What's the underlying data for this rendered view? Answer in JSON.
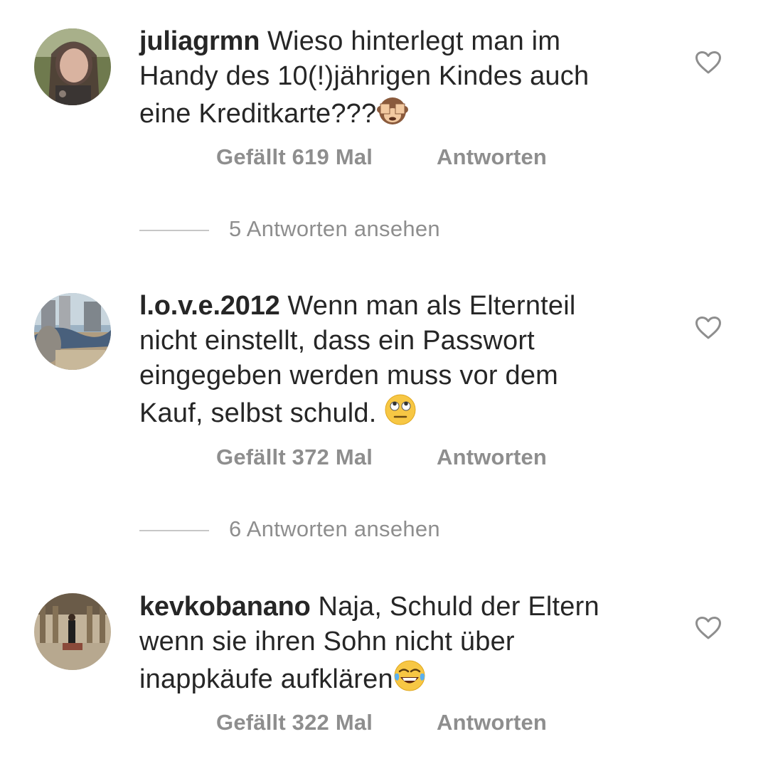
{
  "comments": [
    {
      "username": "juliagrmn",
      "lines": [
        "Wieso hinterlegt man im",
        "Handy des 10(!)jährigen Kindes auch",
        "eine Kreditkarte???"
      ],
      "emoji": "see-no-evil-monkey-icon",
      "likes": "Gefällt 619 Mal",
      "reply": "Antworten",
      "view_replies": "5 Antworten ansehen"
    },
    {
      "username": "l.o.v.e.2012",
      "lines": [
        "Wenn man als Elternteil",
        "nicht einstellt, dass ein Passwort",
        "eingegeben werden muss vor dem",
        "Kauf, selbst schuld."
      ],
      "emoji": "face-with-rolling-eyes-icon",
      "likes": "Gefällt 372 Mal",
      "reply": "Antworten",
      "view_replies": "6 Antworten ansehen"
    },
    {
      "username": "kevkobanano",
      "lines": [
        "Naja, Schuld der Eltern",
        "wenn sie ihren Sohn nicht über",
        "inappkäufe aufklären"
      ],
      "emoji": "face-with-tears-of-joy-icon",
      "likes": "Gefällt 322 Mal",
      "reply": "Antworten"
    }
  ],
  "colors": {
    "text": "#262626",
    "meta": "#8e8e8e",
    "rule": "#c7c7c7",
    "heart": "#8e8e8e"
  }
}
